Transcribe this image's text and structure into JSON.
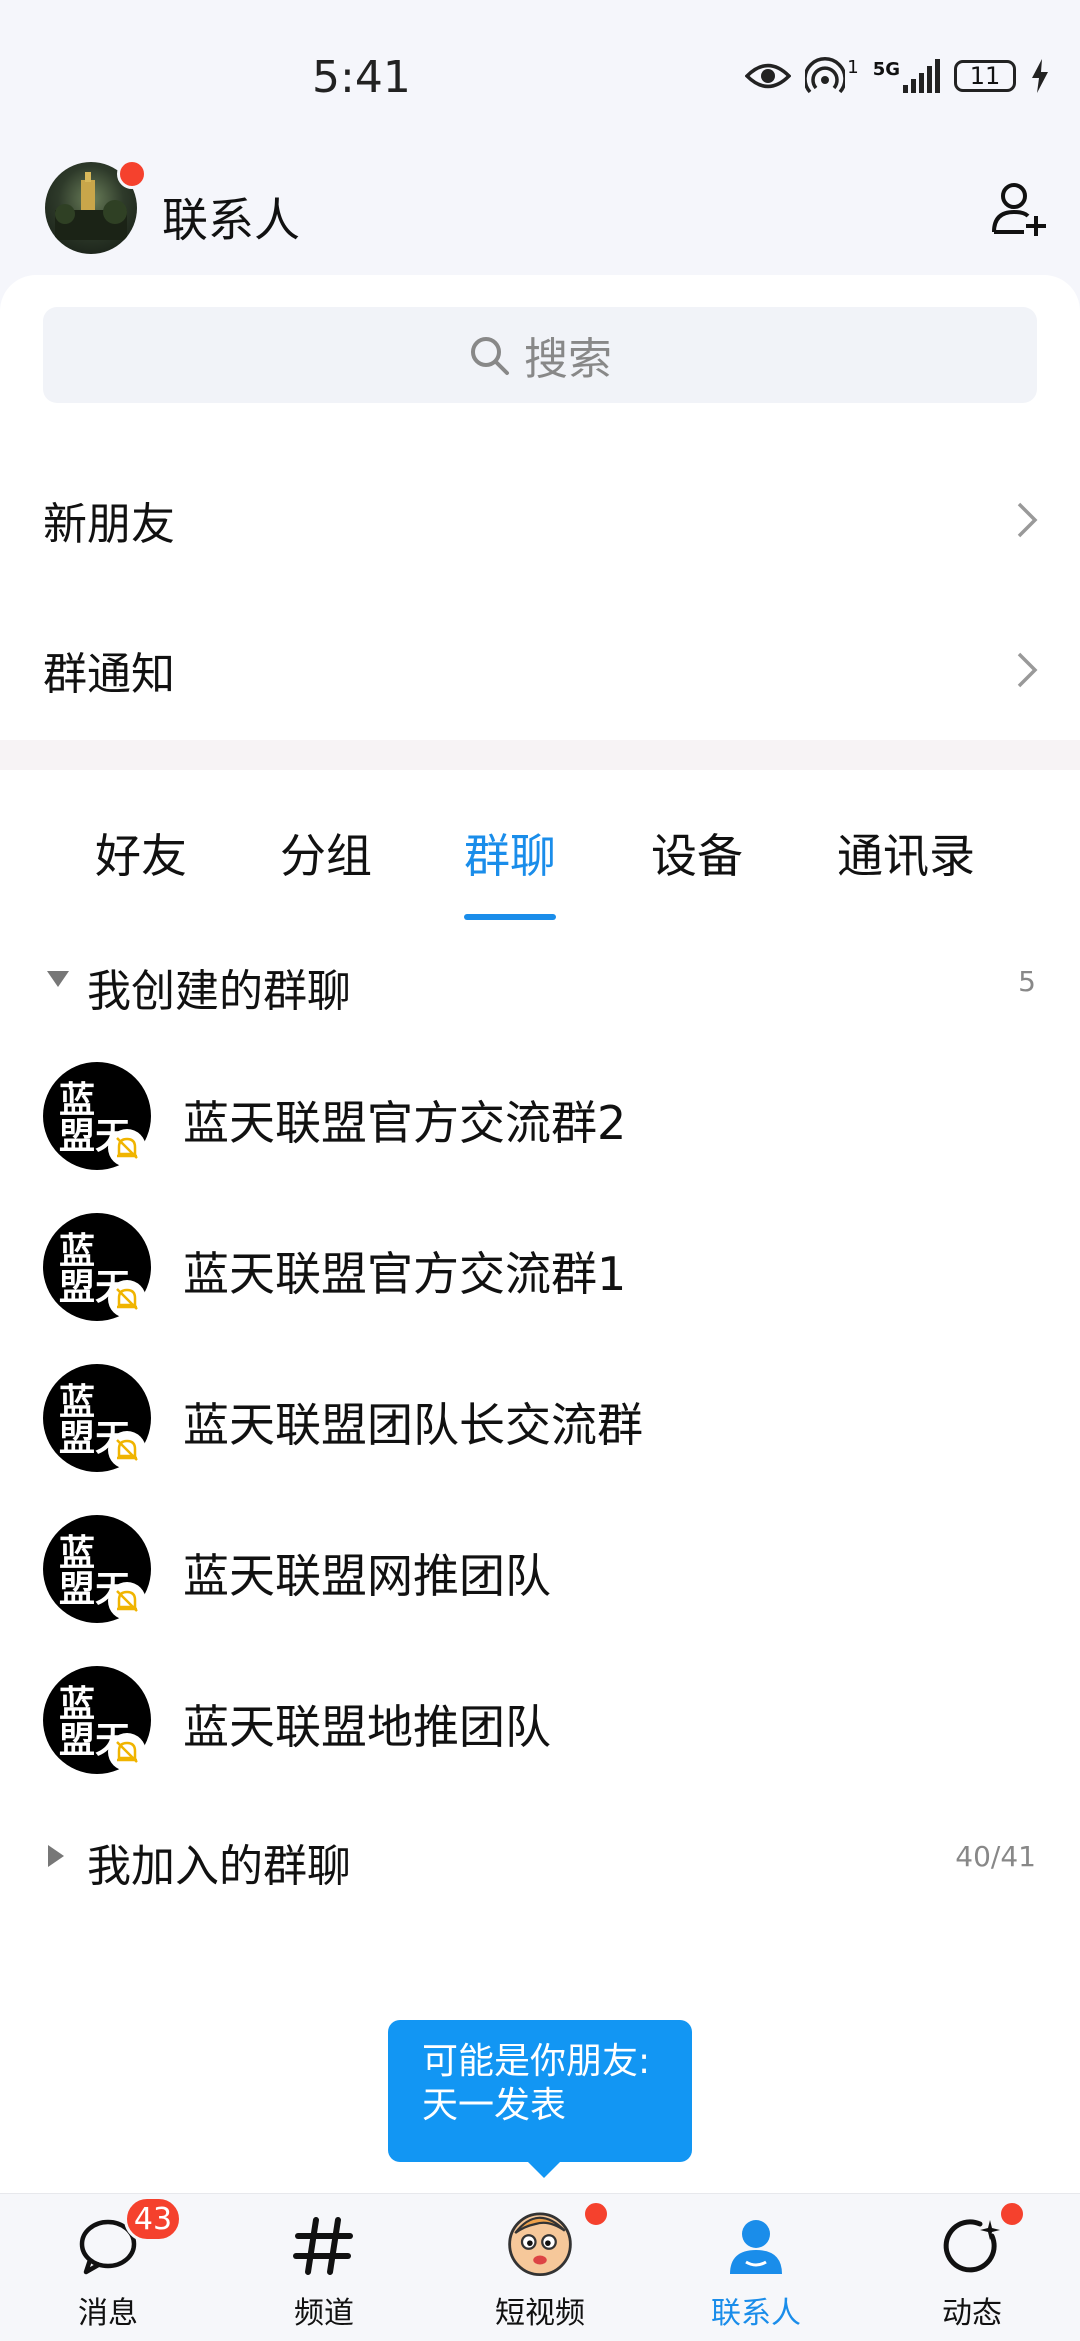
{
  "status": {
    "time": "5:41",
    "signal_label": "5G",
    "sim_number": "1",
    "battery": "11"
  },
  "header": {
    "title": "联系人"
  },
  "search": {
    "placeholder": "搜索"
  },
  "rows": [
    {
      "label": "新朋友"
    },
    {
      "label": "群通知"
    }
  ],
  "tabs": [
    {
      "label": "好友",
      "active": false
    },
    {
      "label": "分组",
      "active": false
    },
    {
      "label": "群聊",
      "active": true
    },
    {
      "label": "设备",
      "active": false
    },
    {
      "label": "通讯录",
      "active": false
    }
  ],
  "created_section": {
    "label": "我创建的群聊",
    "count": "5"
  },
  "groups": [
    {
      "name": "蓝天联盟官方交流群2",
      "muted": true
    },
    {
      "name": "蓝天联盟官方交流群1",
      "muted": true
    },
    {
      "name": "蓝天联盟团队长交流群",
      "muted": true
    },
    {
      "name": "蓝天联盟网推团队",
      "muted": true
    },
    {
      "name": "蓝天联盟地推团队",
      "muted": true
    }
  ],
  "group_logo": {
    "line1": "蓝",
    "line2": "盟天"
  },
  "joined_section": {
    "label": "我加入的群聊",
    "count": "40/41"
  },
  "tooltip": {
    "line1": "可能是你朋友:",
    "line2": "天一发表"
  },
  "nav": [
    {
      "label": "消息",
      "icon": "message-icon",
      "badge": "43"
    },
    {
      "label": "频道",
      "icon": "channel-hash-icon"
    },
    {
      "label": "短视频",
      "icon": "short-video-avatar-icon",
      "dot": true
    },
    {
      "label": "联系人",
      "icon": "contacts-person-icon",
      "active": true
    },
    {
      "label": "动态",
      "icon": "feed-icon",
      "dot": true
    }
  ],
  "colors": {
    "accent": "#1a8dea",
    "badge": "#f5412d",
    "mute": "#f0b400"
  }
}
